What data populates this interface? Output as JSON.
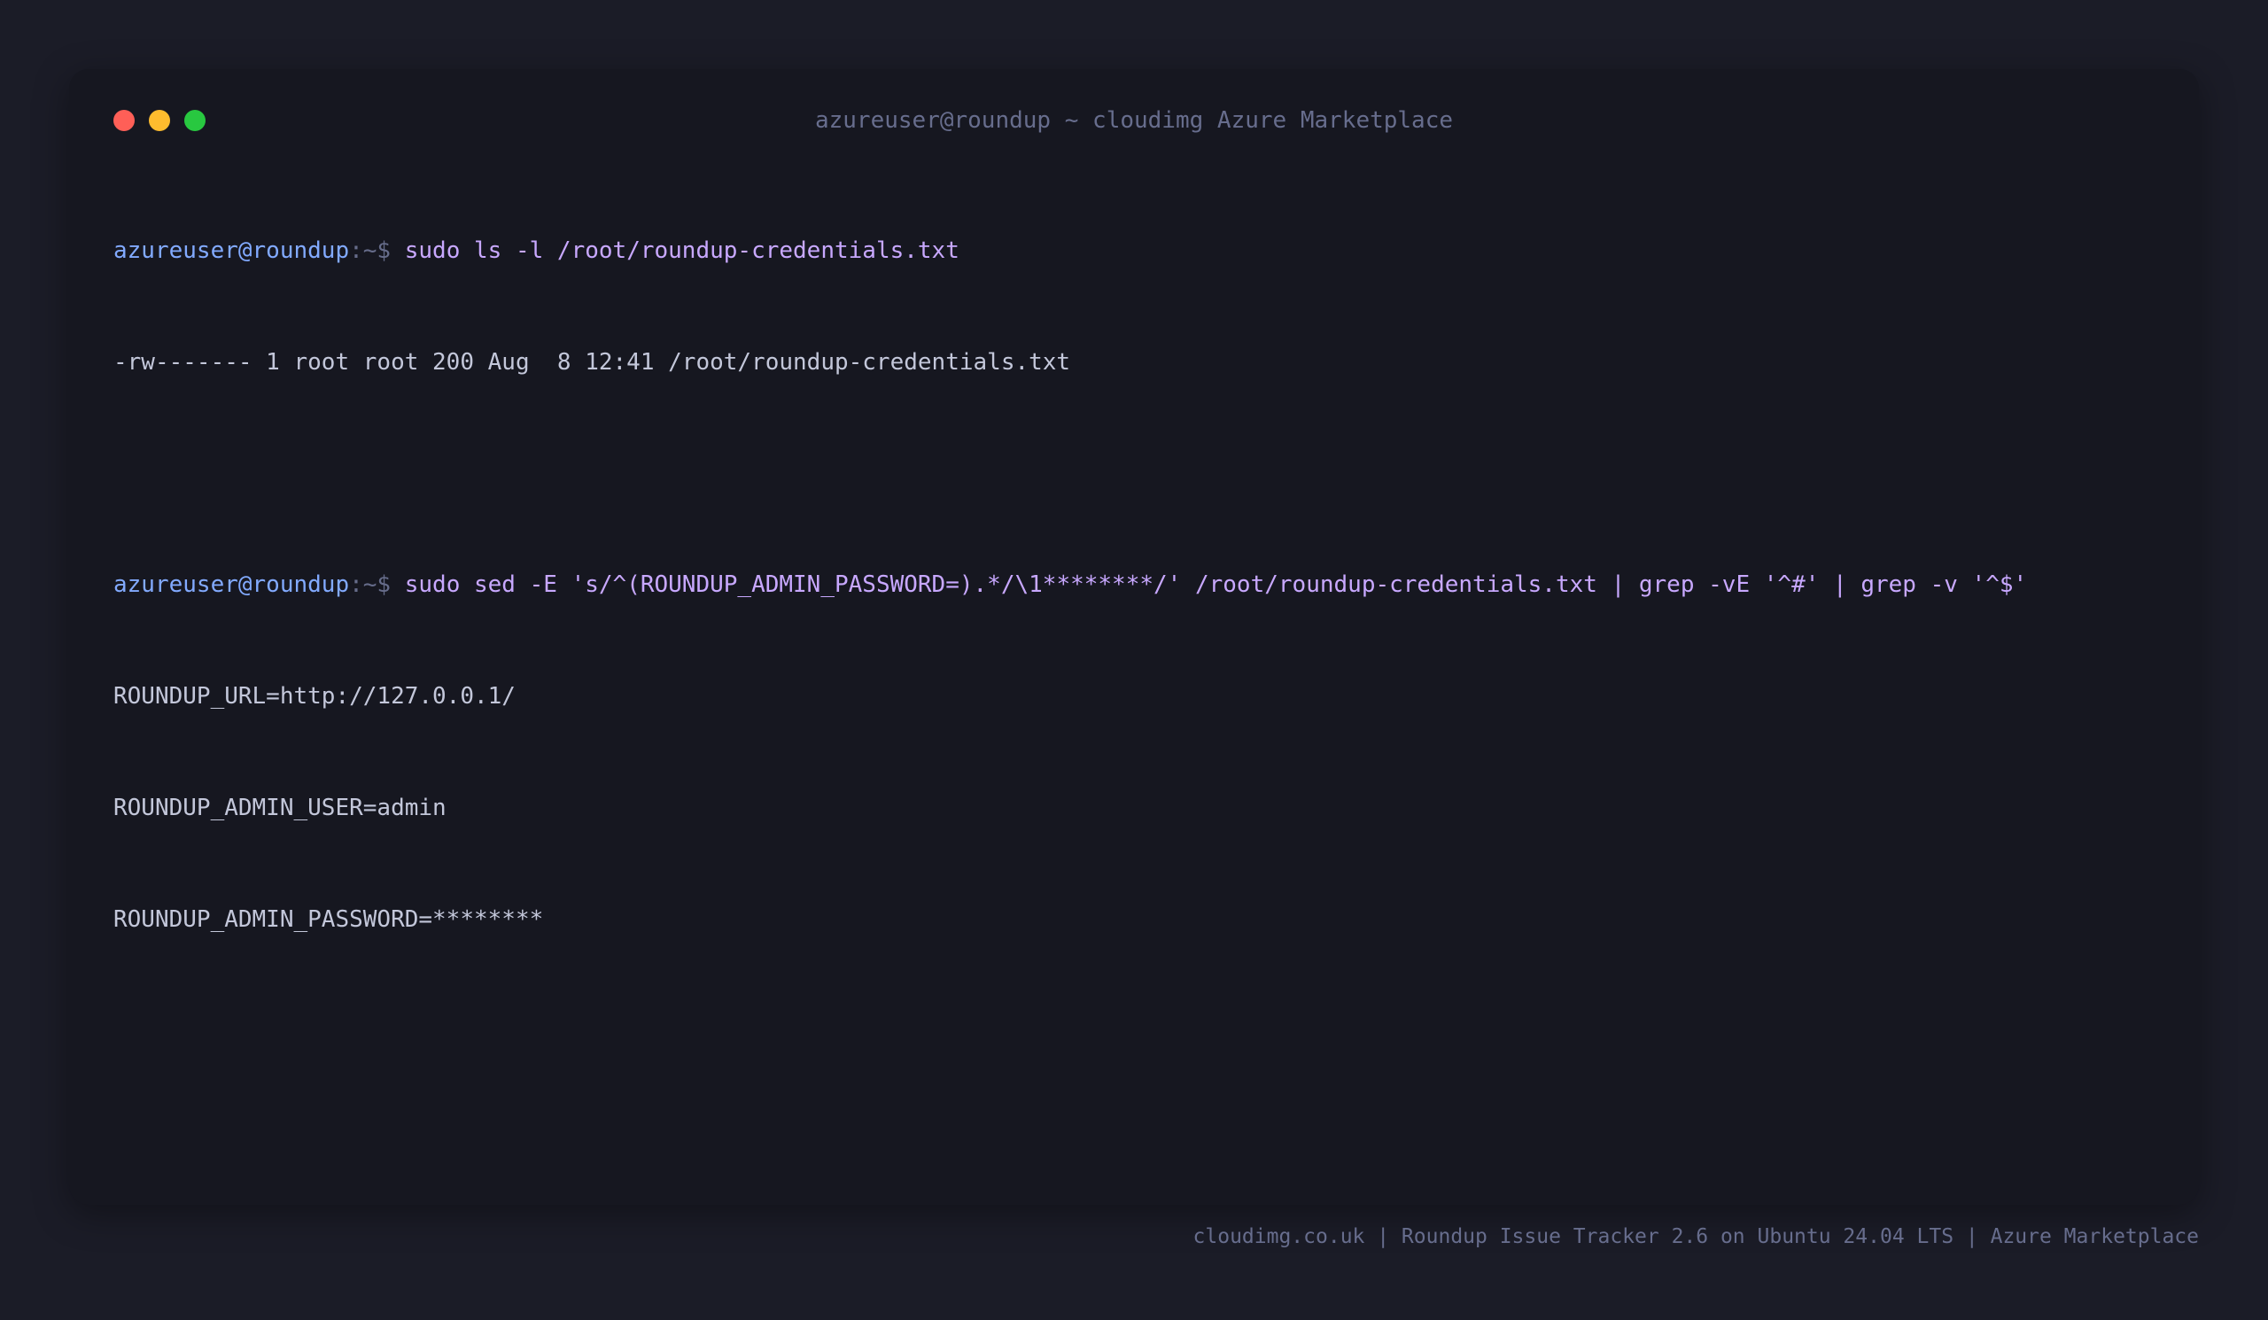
{
  "window": {
    "title": "azureuser@roundup ~ cloudimg Azure Marketplace"
  },
  "terminal": {
    "prompt_user": "azureuser@roundup",
    "prompt_sep": ":~$ ",
    "commands": [
      {
        "input": "sudo ls -l /root/roundup-credentials.txt",
        "output": [
          "-rw------- 1 root root 200 Aug  8 12:41 /root/roundup-credentials.txt"
        ]
      },
      {
        "input": "sudo sed -E 's/^(ROUNDUP_ADMIN_PASSWORD=).*/\\1********/' /root/roundup-credentials.txt | grep -vE '^#' | grep -v '^$'",
        "output": [
          "ROUNDUP_URL=http://127.0.0.1/",
          "ROUNDUP_ADMIN_USER=admin",
          "ROUNDUP_ADMIN_PASSWORD=********"
        ]
      }
    ]
  },
  "footer": {
    "text": "cloudimg.co.uk | Roundup Issue Tracker 2.6 on Ubuntu 24.04 LTS | Azure Marketplace"
  },
  "colors": {
    "background": "#1b1c27",
    "window": "#161720",
    "prompt_user": "#82aaff",
    "command": "#c8a8ff",
    "output": "#c3c7da",
    "muted": "#676d8d"
  }
}
